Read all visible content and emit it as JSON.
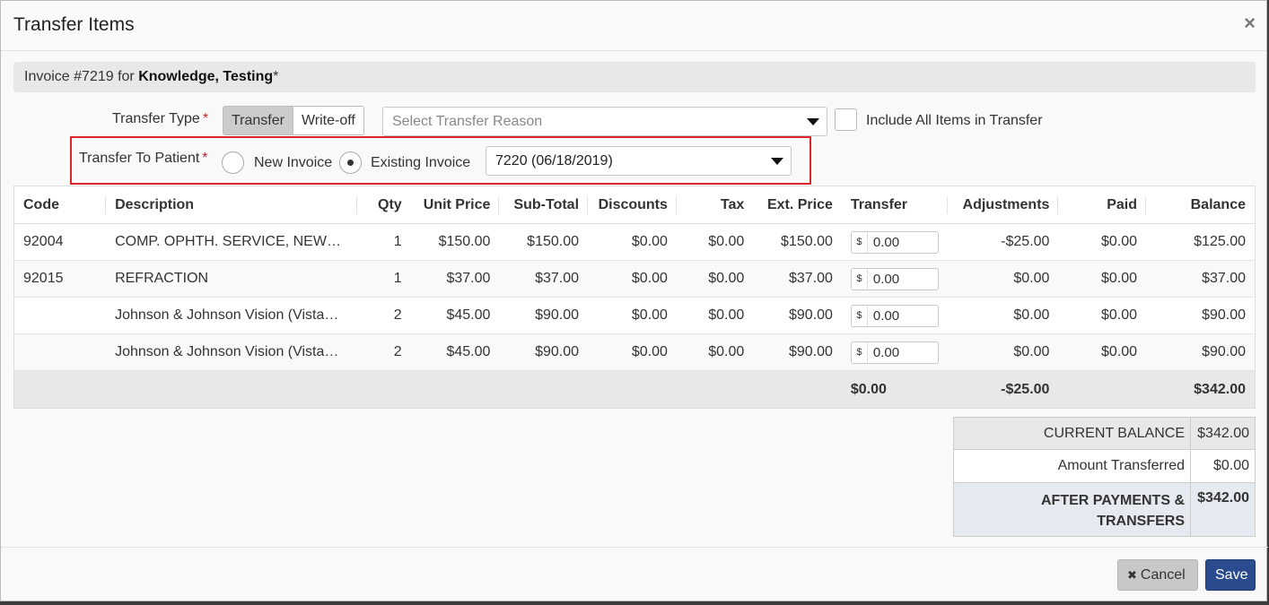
{
  "modal": {
    "title": "Transfer Items",
    "close_glyph": "×"
  },
  "invoice": {
    "prefix": "Invoice #7219 for",
    "patient": "Knowledge, Testing",
    "suffix": "*"
  },
  "transfer_type": {
    "label": "Transfer Type",
    "required_mark": "*",
    "options": [
      "Transfer",
      "Write-off"
    ],
    "selected": "Transfer"
  },
  "transfer_reason": {
    "placeholder": "Select Transfer Reason",
    "value": ""
  },
  "include_all": {
    "label": "Include All Items in Transfer",
    "checked": false
  },
  "transfer_to": {
    "label": "Transfer To Patient",
    "required_mark": "*",
    "new_invoice_label": "New Invoice",
    "existing_invoice_label": "Existing Invoice",
    "selected": "Existing Invoice",
    "existing_invoice_value": "7220 (06/18/2019)"
  },
  "table": {
    "headers": [
      "Code",
      "Description",
      "Qty",
      "Unit Price",
      "Sub-Total",
      "Discounts",
      "Tax",
      "Ext. Price",
      "Transfer",
      "Adjustments",
      "Paid",
      "Balance"
    ],
    "currency_addon": "$",
    "rows": [
      {
        "code": "92004",
        "description": "COMP. OPHTH. SERVICE, NEW…",
        "qty": "1",
        "unit_price": "$150.00",
        "subtotal": "$150.00",
        "discounts": "$0.00",
        "tax": "$0.00",
        "ext_price": "$150.00",
        "transfer": "0.00",
        "adjustments": "-$25.00",
        "paid": "$0.00",
        "balance": "$125.00"
      },
      {
        "code": "92015",
        "description": "REFRACTION",
        "qty": "1",
        "unit_price": "$37.00",
        "subtotal": "$37.00",
        "discounts": "$0.00",
        "tax": "$0.00",
        "ext_price": "$37.00",
        "transfer": "0.00",
        "adjustments": "$0.00",
        "paid": "$0.00",
        "balance": "$37.00"
      },
      {
        "code": "",
        "description": "Johnson & Johnson Vision (Vista…",
        "qty": "2",
        "unit_price": "$45.00",
        "subtotal": "$90.00",
        "discounts": "$0.00",
        "tax": "$0.00",
        "ext_price": "$90.00",
        "transfer": "0.00",
        "adjustments": "$0.00",
        "paid": "$0.00",
        "balance": "$90.00"
      },
      {
        "code": "",
        "description": "Johnson & Johnson Vision (Vista…",
        "qty": "2",
        "unit_price": "$45.00",
        "subtotal": "$90.00",
        "discounts": "$0.00",
        "tax": "$0.00",
        "ext_price": "$90.00",
        "transfer": "0.00",
        "adjustments": "$0.00",
        "paid": "$0.00",
        "balance": "$90.00"
      }
    ],
    "totals": {
      "transfer": "$0.00",
      "adjustments": "-$25.00",
      "balance": "$342.00"
    }
  },
  "summary": {
    "current_balance_label": "CURRENT BALANCE",
    "current_balance": "$342.00",
    "amount_transferred_label": "Amount Transferred",
    "amount_transferred": "$0.00",
    "after_label_line1": "AFTER PAYMENTS &",
    "after_label_line2": "TRANSFERS",
    "after_value": "$342.00"
  },
  "footer": {
    "cancel_label": "Cancel",
    "cancel_glyph": "✖",
    "save_label": "Save"
  },
  "colors": {
    "required": "#c0282d",
    "highlight": "#d9262b",
    "save_button": "#2a4c8f"
  }
}
